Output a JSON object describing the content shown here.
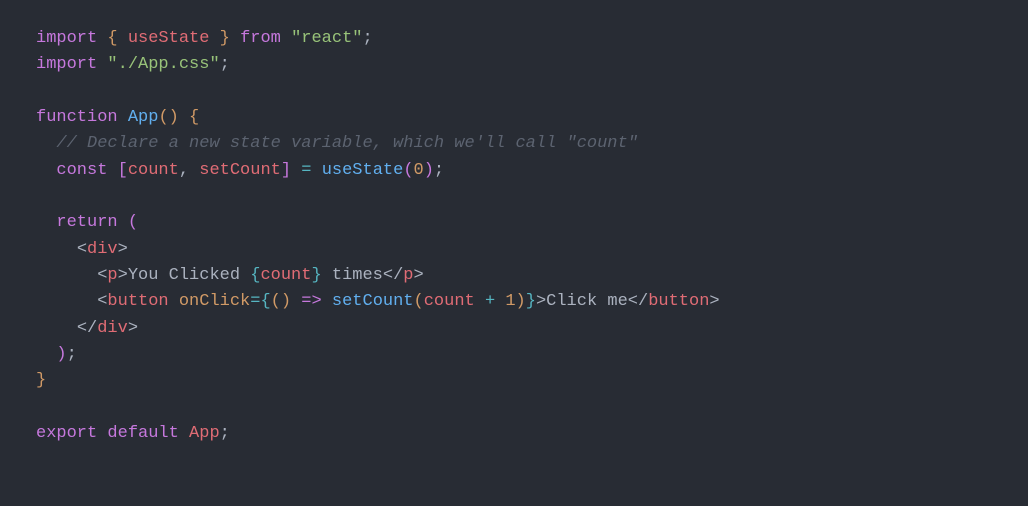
{
  "code": {
    "l1": {
      "import": "import",
      "lb": "{",
      "useState": "useState",
      "rb": "}",
      "from": "from",
      "react": "\"react\"",
      "semi": ";"
    },
    "l2": {
      "import": "import",
      "appcss": "\"./App.css\"",
      "semi": ";"
    },
    "l3": "",
    "l4": {
      "function": "function",
      "App": "App",
      "lp": "(",
      "rp": ")",
      "lb": "{"
    },
    "l5": {
      "comment": "// Declare a new state variable, which we'll call \"count\""
    },
    "l6": {
      "const": "const",
      "lbr": "[",
      "count": "count",
      "comma": ",",
      "setCount": "setCount",
      "rbr": "]",
      "eq": "=",
      "useState": "useState",
      "lp": "(",
      "zero": "0",
      "rp": ")",
      "semi": ";"
    },
    "l7": "",
    "l8": {
      "return": "return",
      "lp": "("
    },
    "l9": {
      "lt": "<",
      "div": "div",
      "gt": ">"
    },
    "l10": {
      "lt": "<",
      "p": "p",
      "gt": ">",
      "text1": "You Clicked ",
      "lb": "{",
      "count": "count",
      "rb": "}",
      "text2": " times",
      "lt2": "</",
      "p2": "p",
      "gt2": ">"
    },
    "l11": {
      "lt": "<",
      "button": "button",
      "onClick": "onClick",
      "eq": "=",
      "lb": "{",
      "lp": "(",
      "rp": ")",
      "arrow": "=>",
      "setCount": "setCount",
      "lp2": "(",
      "count": "count",
      "plus": "+",
      "one": "1",
      "rp2": ")",
      "rb": "}",
      "gt": ">",
      "text": "Click me",
      "lt2": "</",
      "button2": "button",
      "gt2": ">"
    },
    "l12": {
      "lt": "</",
      "div": "div",
      "gt": ">"
    },
    "l13": {
      "rp": ")",
      "semi": ";"
    },
    "l14": {
      "rb": "}"
    },
    "l15": "",
    "l16": {
      "export": "export",
      "default": "default",
      "App": "App",
      "semi": ";"
    }
  }
}
